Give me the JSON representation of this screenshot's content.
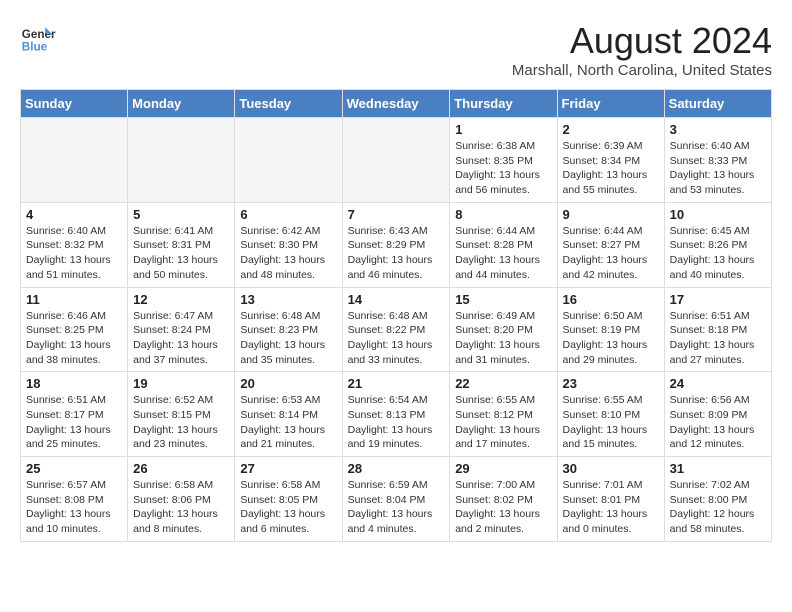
{
  "header": {
    "logo_line1": "General",
    "logo_line2": "Blue",
    "month_title": "August 2024",
    "location": "Marshall, North Carolina, United States"
  },
  "weekdays": [
    "Sunday",
    "Monday",
    "Tuesday",
    "Wednesday",
    "Thursday",
    "Friday",
    "Saturday"
  ],
  "weeks": [
    [
      {
        "day": "",
        "empty": true
      },
      {
        "day": "",
        "empty": true
      },
      {
        "day": "",
        "empty": true
      },
      {
        "day": "",
        "empty": true
      },
      {
        "day": "1",
        "sunrise": "6:38 AM",
        "sunset": "8:35 PM",
        "daylight": "13 hours and 56 minutes."
      },
      {
        "day": "2",
        "sunrise": "6:39 AM",
        "sunset": "8:34 PM",
        "daylight": "13 hours and 55 minutes."
      },
      {
        "day": "3",
        "sunrise": "6:40 AM",
        "sunset": "8:33 PM",
        "daylight": "13 hours and 53 minutes."
      }
    ],
    [
      {
        "day": "4",
        "sunrise": "6:40 AM",
        "sunset": "8:32 PM",
        "daylight": "13 hours and 51 minutes."
      },
      {
        "day": "5",
        "sunrise": "6:41 AM",
        "sunset": "8:31 PM",
        "daylight": "13 hours and 50 minutes."
      },
      {
        "day": "6",
        "sunrise": "6:42 AM",
        "sunset": "8:30 PM",
        "daylight": "13 hours and 48 minutes."
      },
      {
        "day": "7",
        "sunrise": "6:43 AM",
        "sunset": "8:29 PM",
        "daylight": "13 hours and 46 minutes."
      },
      {
        "day": "8",
        "sunrise": "6:44 AM",
        "sunset": "8:28 PM",
        "daylight": "13 hours and 44 minutes."
      },
      {
        "day": "9",
        "sunrise": "6:44 AM",
        "sunset": "8:27 PM",
        "daylight": "13 hours and 42 minutes."
      },
      {
        "day": "10",
        "sunrise": "6:45 AM",
        "sunset": "8:26 PM",
        "daylight": "13 hours and 40 minutes."
      }
    ],
    [
      {
        "day": "11",
        "sunrise": "6:46 AM",
        "sunset": "8:25 PM",
        "daylight": "13 hours and 38 minutes."
      },
      {
        "day": "12",
        "sunrise": "6:47 AM",
        "sunset": "8:24 PM",
        "daylight": "13 hours and 37 minutes."
      },
      {
        "day": "13",
        "sunrise": "6:48 AM",
        "sunset": "8:23 PM",
        "daylight": "13 hours and 35 minutes."
      },
      {
        "day": "14",
        "sunrise": "6:48 AM",
        "sunset": "8:22 PM",
        "daylight": "13 hours and 33 minutes."
      },
      {
        "day": "15",
        "sunrise": "6:49 AM",
        "sunset": "8:20 PM",
        "daylight": "13 hours and 31 minutes."
      },
      {
        "day": "16",
        "sunrise": "6:50 AM",
        "sunset": "8:19 PM",
        "daylight": "13 hours and 29 minutes."
      },
      {
        "day": "17",
        "sunrise": "6:51 AM",
        "sunset": "8:18 PM",
        "daylight": "13 hours and 27 minutes."
      }
    ],
    [
      {
        "day": "18",
        "sunrise": "6:51 AM",
        "sunset": "8:17 PM",
        "daylight": "13 hours and 25 minutes."
      },
      {
        "day": "19",
        "sunrise": "6:52 AM",
        "sunset": "8:15 PM",
        "daylight": "13 hours and 23 minutes."
      },
      {
        "day": "20",
        "sunrise": "6:53 AM",
        "sunset": "8:14 PM",
        "daylight": "13 hours and 21 minutes."
      },
      {
        "day": "21",
        "sunrise": "6:54 AM",
        "sunset": "8:13 PM",
        "daylight": "13 hours and 19 minutes."
      },
      {
        "day": "22",
        "sunrise": "6:55 AM",
        "sunset": "8:12 PM",
        "daylight": "13 hours and 17 minutes."
      },
      {
        "day": "23",
        "sunrise": "6:55 AM",
        "sunset": "8:10 PM",
        "daylight": "13 hours and 15 minutes."
      },
      {
        "day": "24",
        "sunrise": "6:56 AM",
        "sunset": "8:09 PM",
        "daylight": "13 hours and 12 minutes."
      }
    ],
    [
      {
        "day": "25",
        "sunrise": "6:57 AM",
        "sunset": "8:08 PM",
        "daylight": "13 hours and 10 minutes."
      },
      {
        "day": "26",
        "sunrise": "6:58 AM",
        "sunset": "8:06 PM",
        "daylight": "13 hours and 8 minutes."
      },
      {
        "day": "27",
        "sunrise": "6:58 AM",
        "sunset": "8:05 PM",
        "daylight": "13 hours and 6 minutes."
      },
      {
        "day": "28",
        "sunrise": "6:59 AM",
        "sunset": "8:04 PM",
        "daylight": "13 hours and 4 minutes."
      },
      {
        "day": "29",
        "sunrise": "7:00 AM",
        "sunset": "8:02 PM",
        "daylight": "13 hours and 2 minutes."
      },
      {
        "day": "30",
        "sunrise": "7:01 AM",
        "sunset": "8:01 PM",
        "daylight": "13 hours and 0 minutes."
      },
      {
        "day": "31",
        "sunrise": "7:02 AM",
        "sunset": "8:00 PM",
        "daylight": "12 hours and 58 minutes."
      }
    ]
  ],
  "labels": {
    "sunrise_prefix": "Sunrise: ",
    "sunset_prefix": "Sunset: ",
    "daylight_prefix": "Daylight: "
  }
}
